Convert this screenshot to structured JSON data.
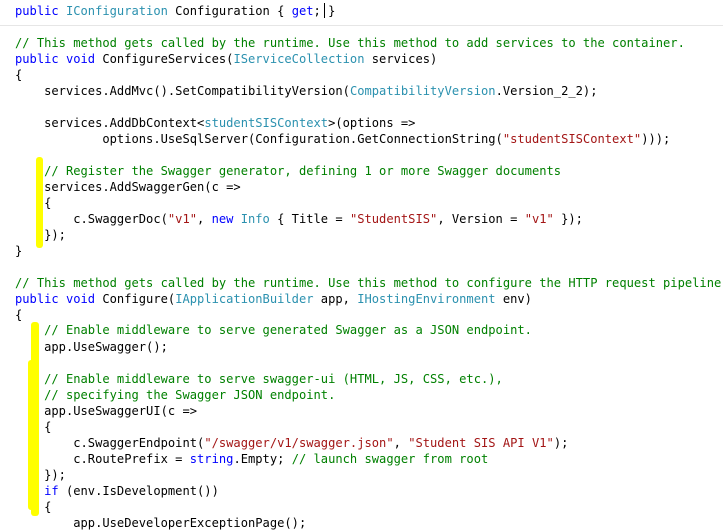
{
  "colors": {
    "background": "#ffffff",
    "keyword": "#0000ff",
    "type": "#2b91af",
    "string": "#a31515",
    "comment": "#008000",
    "plain": "#000000",
    "highlight": "#ffff00"
  },
  "code_lines": [
    [
      [
        "kw",
        "public "
      ],
      [
        "type",
        "IConfiguration"
      ],
      [
        "plain",
        " Configuration { "
      ],
      [
        "kw",
        "get"
      ],
      [
        "plain",
        "; }"
      ]
    ],
    [],
    [
      [
        "cmt",
        "// This method gets called by the runtime. Use this method to add services to the container."
      ]
    ],
    [
      [
        "kw",
        "public void "
      ],
      [
        "plain",
        "ConfigureServices("
      ],
      [
        "type",
        "IServiceCollection"
      ],
      [
        "plain",
        " services)"
      ]
    ],
    [
      [
        "plain",
        "{"
      ]
    ],
    [
      [
        "plain",
        "    services.AddMvc().SetCompatibilityVersion("
      ],
      [
        "type",
        "CompatibilityVersion"
      ],
      [
        "plain",
        ".Version_2_2);"
      ]
    ],
    [],
    [
      [
        "plain",
        "    services.AddDbContext<"
      ],
      [
        "type",
        "studentSISContext"
      ],
      [
        "plain",
        ">(options =>"
      ]
    ],
    [
      [
        "plain",
        "            options.UseSqlServer(Configuration.GetConnectionString("
      ],
      [
        "str",
        "\"studentSISContext\""
      ],
      [
        "plain",
        ")));"
      ]
    ],
    [],
    [
      [
        "cmt",
        "    // Register the Swagger generator, defining 1 or more Swagger documents"
      ]
    ],
    [
      [
        "plain",
        "    services.AddSwaggerGen(c =>"
      ]
    ],
    [
      [
        "plain",
        "    {"
      ]
    ],
    [
      [
        "plain",
        "        c.SwaggerDoc("
      ],
      [
        "str",
        "\"v1\""
      ],
      [
        "plain",
        ", "
      ],
      [
        "kw",
        "new "
      ],
      [
        "type",
        "Info"
      ],
      [
        "plain",
        " { Title = "
      ],
      [
        "str",
        "\"StudentSIS\""
      ],
      [
        "plain",
        ", Version = "
      ],
      [
        "str",
        "\"v1\""
      ],
      [
        "plain",
        " });"
      ]
    ],
    [
      [
        "plain",
        "    });"
      ]
    ],
    [
      [
        "plain",
        "}"
      ]
    ],
    [],
    [
      [
        "cmt",
        "// This method gets called by the runtime. Use this method to configure the HTTP request pipeline."
      ]
    ],
    [
      [
        "kw",
        "public void "
      ],
      [
        "plain",
        "Configure("
      ],
      [
        "type",
        "IApplicationBuilder"
      ],
      [
        "plain",
        " app, "
      ],
      [
        "type",
        "IHostingEnvironment"
      ],
      [
        "plain",
        " env)"
      ]
    ],
    [
      [
        "plain",
        "{"
      ]
    ],
    [
      [
        "cmt",
        "    // Enable middleware to serve generated Swagger as a JSON endpoint."
      ]
    ],
    [
      [
        "plain",
        "    app.UseSwagger();"
      ]
    ],
    [],
    [
      [
        "cmt",
        "    // Enable middleware to serve swagger-ui (HTML, JS, CSS, etc.),"
      ]
    ],
    [
      [
        "cmt",
        "    // specifying the Swagger JSON endpoint."
      ]
    ],
    [
      [
        "plain",
        "    app.UseSwaggerUI(c =>"
      ]
    ],
    [
      [
        "plain",
        "    {"
      ]
    ],
    [
      [
        "plain",
        "        c.SwaggerEndpoint("
      ],
      [
        "str",
        "\"/swagger/v1/swagger.json\""
      ],
      [
        "plain",
        ", "
      ],
      [
        "str",
        "\"Student SIS API V1\""
      ],
      [
        "plain",
        ");"
      ]
    ],
    [
      [
        "plain",
        "        c.RoutePrefix = "
      ],
      [
        "kw",
        "string"
      ],
      [
        "plain",
        ".Empty; "
      ],
      [
        "cmt",
        "// launch swagger from root"
      ]
    ],
    [
      [
        "plain",
        "    });"
      ]
    ],
    [
      [
        "plain",
        "    "
      ],
      [
        "kw",
        "if"
      ],
      [
        "plain",
        " (env.IsDevelopment())"
      ]
    ],
    [
      [
        "plain",
        "    {"
      ]
    ],
    [
      [
        "plain",
        "        app.UseDeveloperExceptionPage();"
      ]
    ]
  ]
}
